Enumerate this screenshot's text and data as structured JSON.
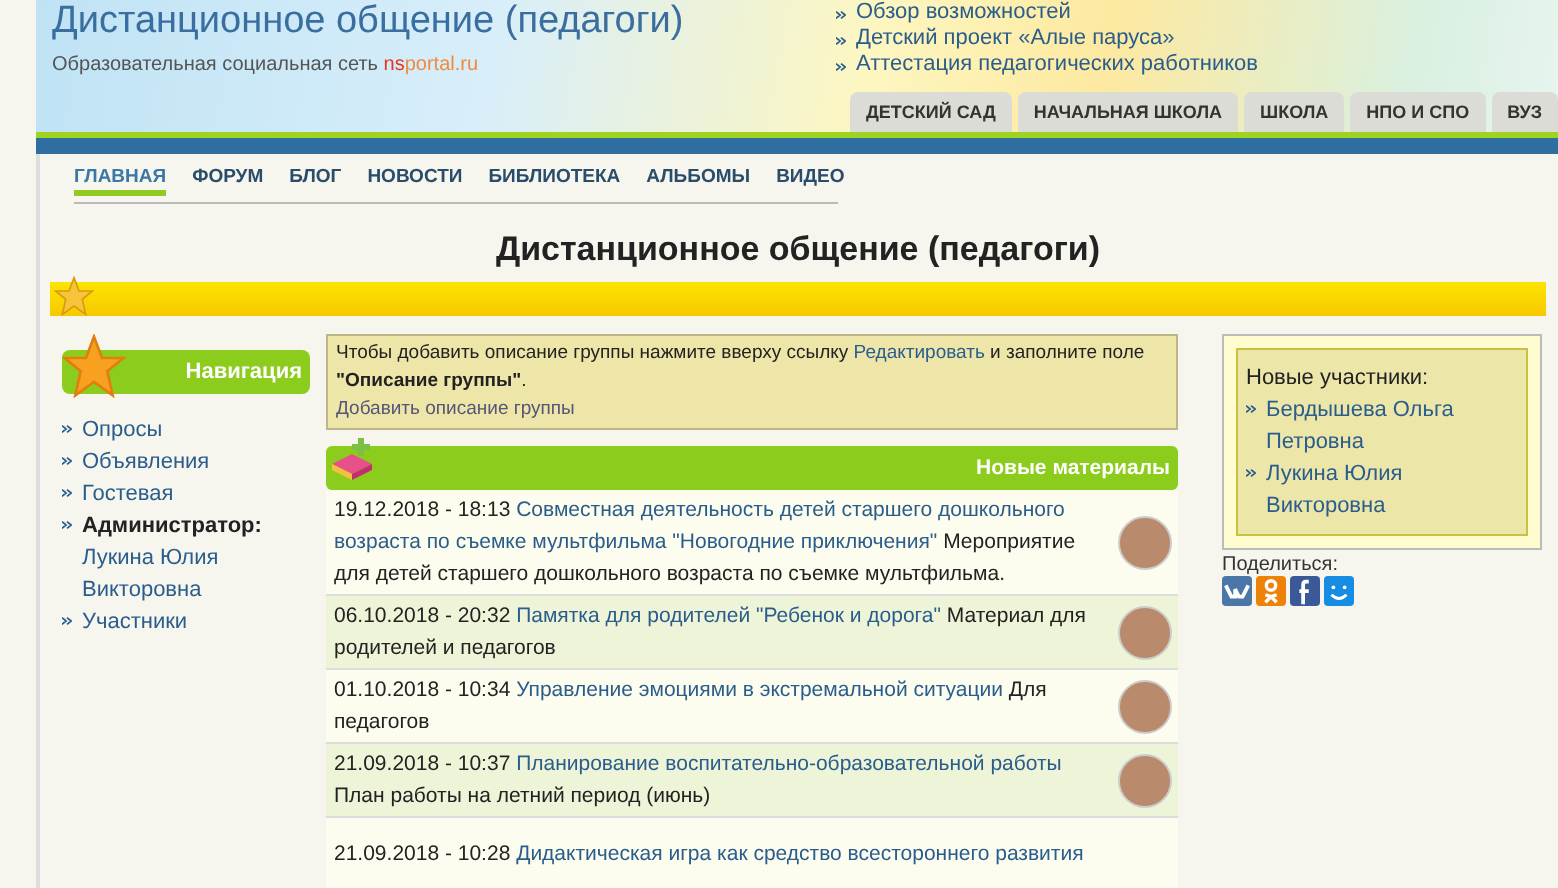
{
  "header": {
    "site_title": "Дистанционное общение (педагоги)",
    "subtitle": "Образовательная социальная сеть ",
    "brand_ns": "ns",
    "brand_rest": "portal.ru",
    "links": [
      "Обзор возможностей",
      "Детский проект «Алые паруса»",
      "Аттестация педагогических работников"
    ],
    "tabs": [
      {
        "label": "ДЕТСКИЙ САД",
        "selected": false
      },
      {
        "label": "НАЧАЛЬНАЯ ШКОЛА",
        "selected": false
      },
      {
        "label": "ШКОЛА",
        "selected": false
      },
      {
        "label": "НПО И СПО",
        "selected": false
      },
      {
        "label": "ВУЗ",
        "selected": false
      }
    ]
  },
  "menu": [
    {
      "label": "ГЛАВНАЯ",
      "selected": true
    },
    {
      "label": "ФОРУМ",
      "selected": false
    },
    {
      "label": "БЛОГ",
      "selected": false
    },
    {
      "label": "НОВОСТИ",
      "selected": false
    },
    {
      "label": "БИБЛИОТЕКА",
      "selected": false
    },
    {
      "label": "АЛЬБОМЫ",
      "selected": false
    },
    {
      "label": "ВИДЕО",
      "selected": false
    }
  ],
  "page_title": "Дистанционное общение (педагоги)",
  "sidebar": {
    "title": "Навигация",
    "items": [
      {
        "kind": "link",
        "label": "Опросы"
      },
      {
        "kind": "link",
        "label": "Объявления"
      },
      {
        "kind": "link",
        "label": "Гостевая"
      },
      {
        "kind": "admin",
        "label": "Администратор:",
        "value": "Лукина Юлия Викторовна"
      },
      {
        "kind": "link",
        "label": "Участники"
      }
    ]
  },
  "notice": {
    "text_before": "Чтобы добавить описание группы нажмите вверху ссылку ",
    "link": "Редактировать",
    "text_after": " и заполните поле ",
    "field_name": "\"Описание группы\"",
    "end": ".",
    "action": "Добавить описание группы"
  },
  "materials": {
    "title": "Новые материалы",
    "rows": [
      {
        "date": "19.12.2018 - 18:13",
        "title_lines": [
          "Совместная деятельность детей старшего дошкольного",
          "возраста по съемке мультфильма \"Новогодние приключения\""
        ],
        "description": "Мероприятие для детей старшего дошкольного возраста по съемке мультфильма."
      },
      {
        "date": "06.10.2018 - 20:32",
        "title_lines": [
          "Памятка для родителей \"Ребенок и дорога\""
        ],
        "description": "Материал для родителей и педагогов"
      },
      {
        "date": "01.10.2018 - 10:34",
        "title_lines": [
          "Управление эмоциями в экстремальной ситуации"
        ],
        "description": "Для педагогов"
      },
      {
        "date": "21.09.2018 - 10:37",
        "title_lines": [
          "Планирование воспитательно-образовательной работы"
        ],
        "description": "План работы на летний период (июнь)"
      },
      {
        "date": "21.09.2018 - 10:28",
        "title_lines": [
          "Дидактическая игра как средство всестороннего развития"
        ]
      }
    ]
  },
  "new_members": {
    "title": "Новые участники:",
    "names": [
      "Бердышева Ольга Петровна",
      "Лукина Юлия Викторовна"
    ]
  },
  "share": {
    "label": "Поделиться:"
  }
}
